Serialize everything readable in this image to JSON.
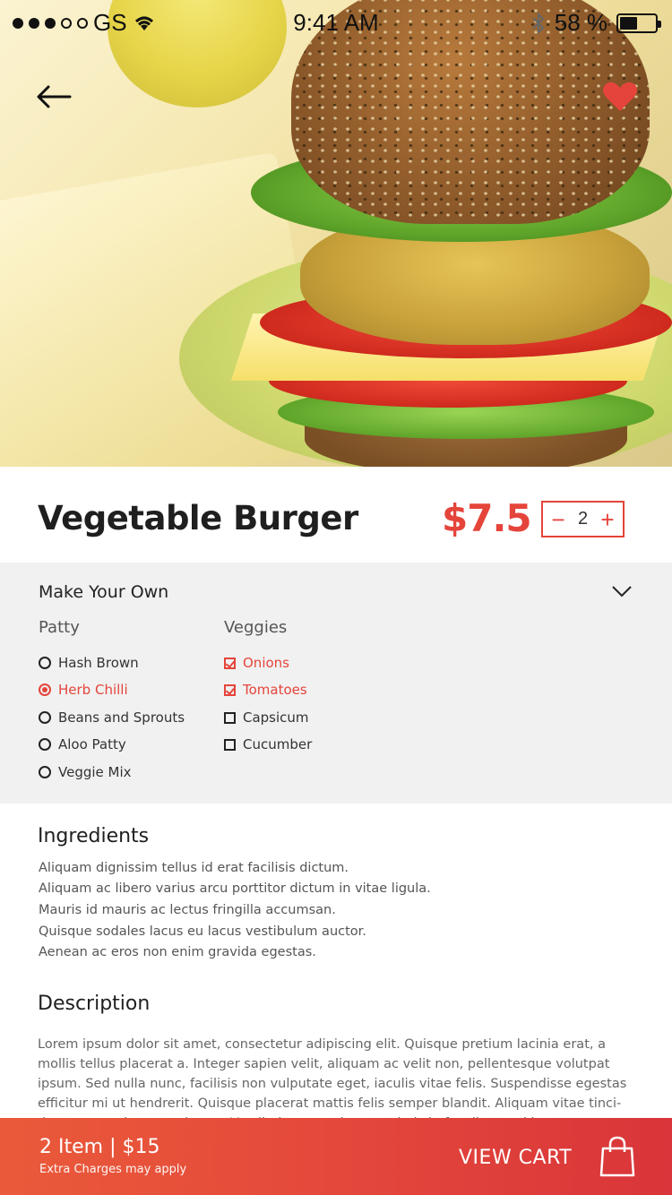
{
  "status_bar": {
    "carrier": "GS",
    "time": "9:41 AM",
    "battery_percent": "58 %",
    "battery_level": 0.5
  },
  "hero": {
    "image_subject": "vegetable burger photo"
  },
  "product": {
    "name": "Vegetable Burger",
    "price": "$7.5",
    "quantity": "2",
    "minus": "−",
    "plus": "+"
  },
  "customize": {
    "title": "Make Your Own",
    "patty": {
      "title": "Patty",
      "options": [
        {
          "label": "Hash Brown",
          "selected": false
        },
        {
          "label": "Herb Chilli",
          "selected": true
        },
        {
          "label": "Beans and Sprouts",
          "selected": false
        },
        {
          "label": "Aloo Patty",
          "selected": false
        },
        {
          "label": "Veggie Mix",
          "selected": false
        }
      ]
    },
    "veggies": {
      "title": "Veggies",
      "options": [
        {
          "label": "Onions",
          "checked": true
        },
        {
          "label": "Tomatoes",
          "checked": true
        },
        {
          "label": "Capsicum",
          "checked": false
        },
        {
          "label": "Cucumber",
          "checked": false
        }
      ]
    }
  },
  "ingredients": {
    "title": "Ingredients",
    "lines": [
      "Aliquam dignissim tellus id erat facilisis dictum.",
      "Aliquam ac libero varius arcu porttitor dictum in vitae ligula.",
      "Mauris id mauris ac lectus fringilla accumsan.",
      "Quisque sodales lacus eu lacus vestibulum auctor.",
      "Aenean ac eros non enim gravida egestas."
    ]
  },
  "description": {
    "title": "Description",
    "text": "Lorem ipsum dolor sit amet, consectetur adipiscing elit. Quisque pretium lacinia erat, a mollis tellus placerat a. Integer sapien velit, aliquam ac velit non, pellentesque volutpat ipsum. Sed nulla nunc, facilisis non vulputate eget, iaculis vitae felis. Suspendisse egestas efficitur mi ut hendrerit. Quisque placerat mattis felis semper blandit. Aliquam vitae tinci-dunt arcu, vel tempus lorem. Vestibulum ante ipsum primis in faucibus orci luctus et ultrices."
  },
  "cart": {
    "summary": "2 Item  |  $15",
    "note": "Extra Charges may apply",
    "button": "VIEW CART"
  },
  "colors": {
    "accent": "#e5443b",
    "section_bg": "#f1f1f1"
  },
  "icons": [
    "back-arrow-icon",
    "heart-icon",
    "chevron-down-icon",
    "shopping-bag-icon",
    "wifi-icon",
    "bluetooth-icon"
  ]
}
